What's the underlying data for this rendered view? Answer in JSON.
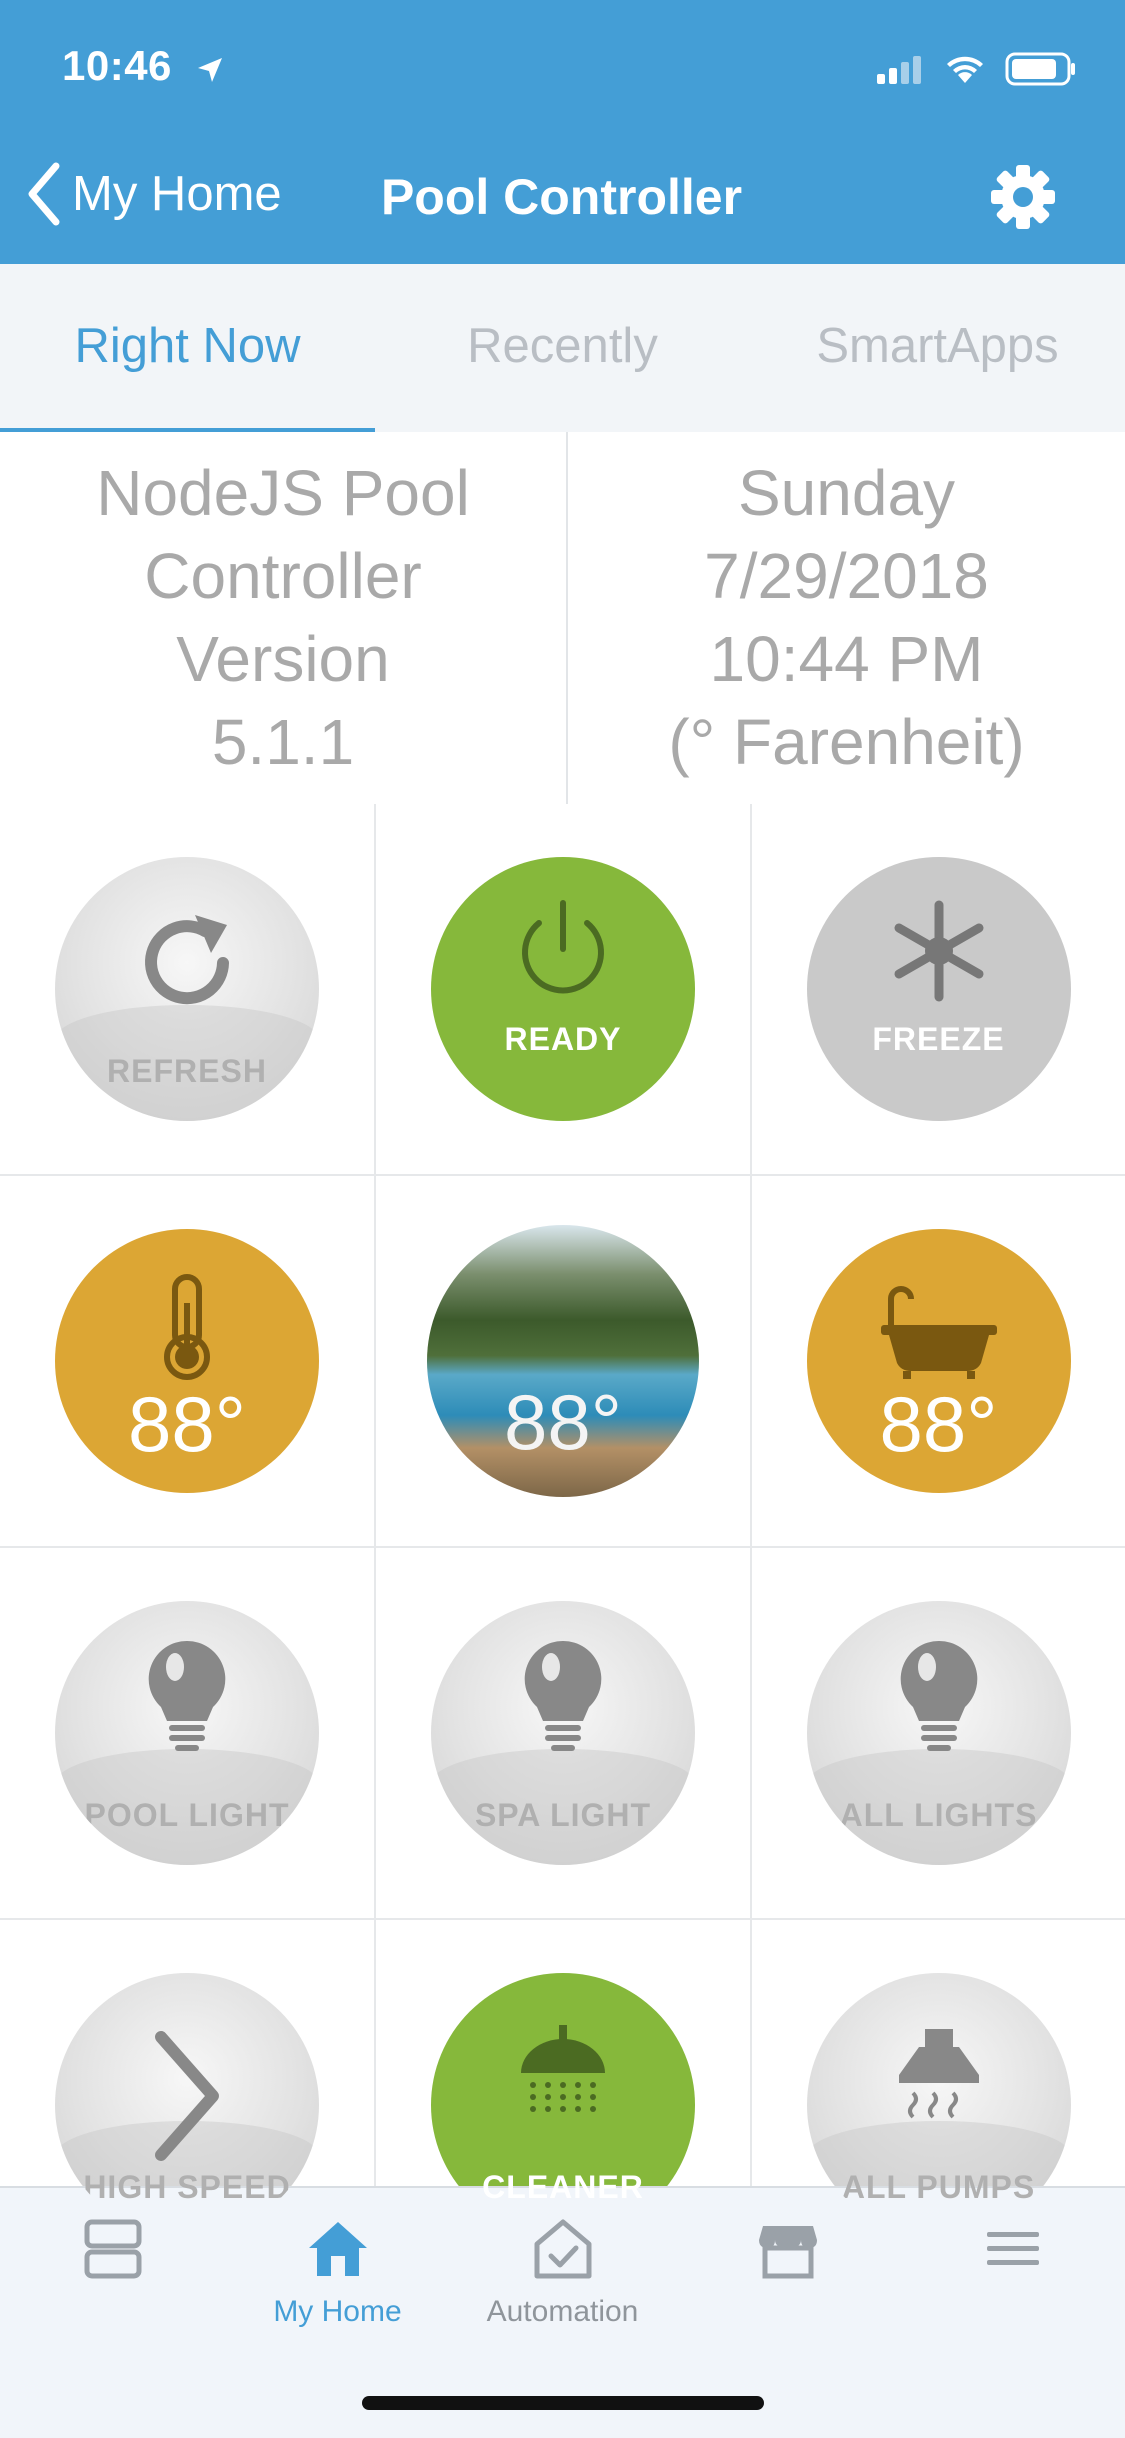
{
  "status_bar": {
    "time": "10:46"
  },
  "nav": {
    "back_label": "My Home",
    "title": "Pool Controller"
  },
  "tabs": [
    {
      "label": "Right Now",
      "active": true
    },
    {
      "label": "Recently",
      "active": false
    },
    {
      "label": "SmartApps",
      "active": false
    }
  ],
  "info": {
    "version_lines": [
      "NodeJS Pool",
      "Controller",
      "Version",
      "5.1.1"
    ],
    "date_lines": [
      "Sunday",
      "7/29/2018",
      "10:44 PM",
      "(° Farenheit)"
    ]
  },
  "tiles": {
    "refresh": "REFRESH",
    "ready": "READY",
    "freeze": "FREEZE",
    "air_temp": "88°",
    "pool_temp": "88°",
    "spa_temp": "88°",
    "pool_light": "POOL LIGHT",
    "spa_light": "SPA LIGHT",
    "all_lights": "ALL LIGHTS",
    "high_speed": "HIGH SPEED",
    "cleaner": "CLEANER",
    "all_pumps": "ALL PUMPS"
  },
  "bottom_nav": [
    {
      "label": "",
      "icon": "dashboard-icon"
    },
    {
      "label": "My Home",
      "icon": "home-icon",
      "active": true
    },
    {
      "label": "Automation",
      "icon": "automation-icon"
    },
    {
      "label": "",
      "icon": "marketplace-icon"
    },
    {
      "label": "",
      "icon": "menu-icon"
    }
  ],
  "colors": {
    "brand_blue": "#449ed6",
    "on_green": "#86b83b",
    "heat_gold": "#dca634",
    "inactive_gray": "#c9c9c9"
  }
}
